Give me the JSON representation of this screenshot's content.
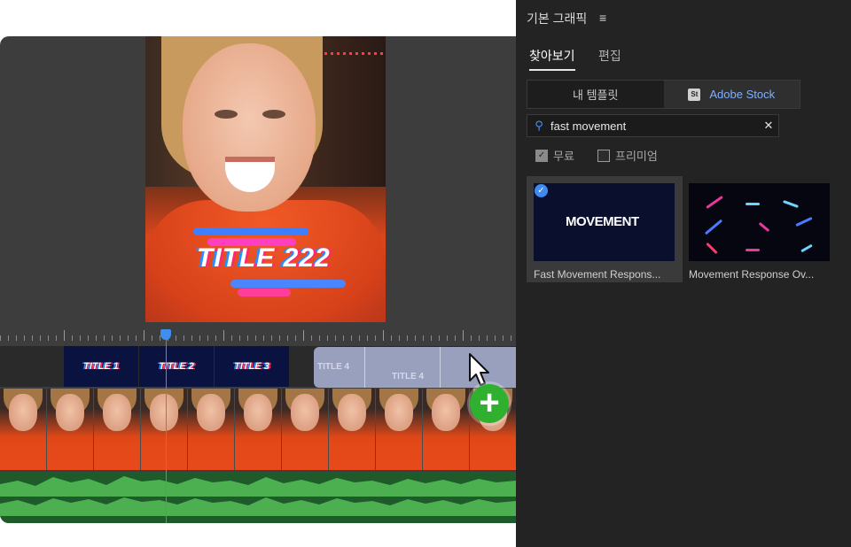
{
  "panel": {
    "title": "기본 그래픽",
    "menu_icon": "≡",
    "tabs": [
      {
        "label": "찾아보기",
        "active": true
      },
      {
        "label": "편집",
        "active": false
      }
    ],
    "segments": [
      {
        "label": "내 템플릿",
        "selected": false
      },
      {
        "label": "Adobe Stock",
        "selected": true,
        "badge": "St"
      }
    ],
    "search": {
      "value": "fast movement",
      "icon": "search-icon",
      "clear_icon": "close-icon"
    },
    "filters": [
      {
        "label": "무료",
        "checked": true
      },
      {
        "label": "프리미엄",
        "checked": false
      }
    ],
    "results": [
      {
        "title": "Fast Movement Respons...",
        "thumb_text": "MOVEMENT",
        "selected": true
      },
      {
        "title": "Movement Response Ov...",
        "thumb_text": "",
        "selected": false
      }
    ]
  },
  "editor": {
    "preview_overlay_text": "TITLE 222",
    "title_clips": [
      "TITLE 1",
      "TITLE 2",
      "TITLE 3"
    ],
    "drag_clip_labels": [
      "TITLE 4",
      "TITLE 4"
    ],
    "add_button_icon": "plus-icon"
  },
  "colors": {
    "accent": "#3e8ff0",
    "add_button": "#2fb02f",
    "panel_bg": "#232323",
    "audio": "#4caf50"
  }
}
